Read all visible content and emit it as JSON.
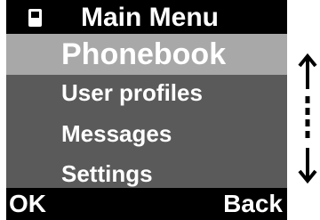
{
  "header": {
    "icon": "phone-icon",
    "title": "Main Menu"
  },
  "menu": {
    "items": [
      {
        "label": "Phonebook",
        "selected": true
      },
      {
        "label": "User profiles",
        "selected": false
      },
      {
        "label": "Messages",
        "selected": false
      },
      {
        "label": "Settings",
        "selected": false
      }
    ]
  },
  "softkeys": {
    "left": "OK",
    "right": "Back"
  },
  "scroll_indicator": {
    "icon": "scroll-up-down-icon"
  },
  "colors": {
    "background": "#000000",
    "menu_background": "#5a5a5a",
    "selected_background": "#a8a8a8",
    "text": "#ffffff"
  }
}
